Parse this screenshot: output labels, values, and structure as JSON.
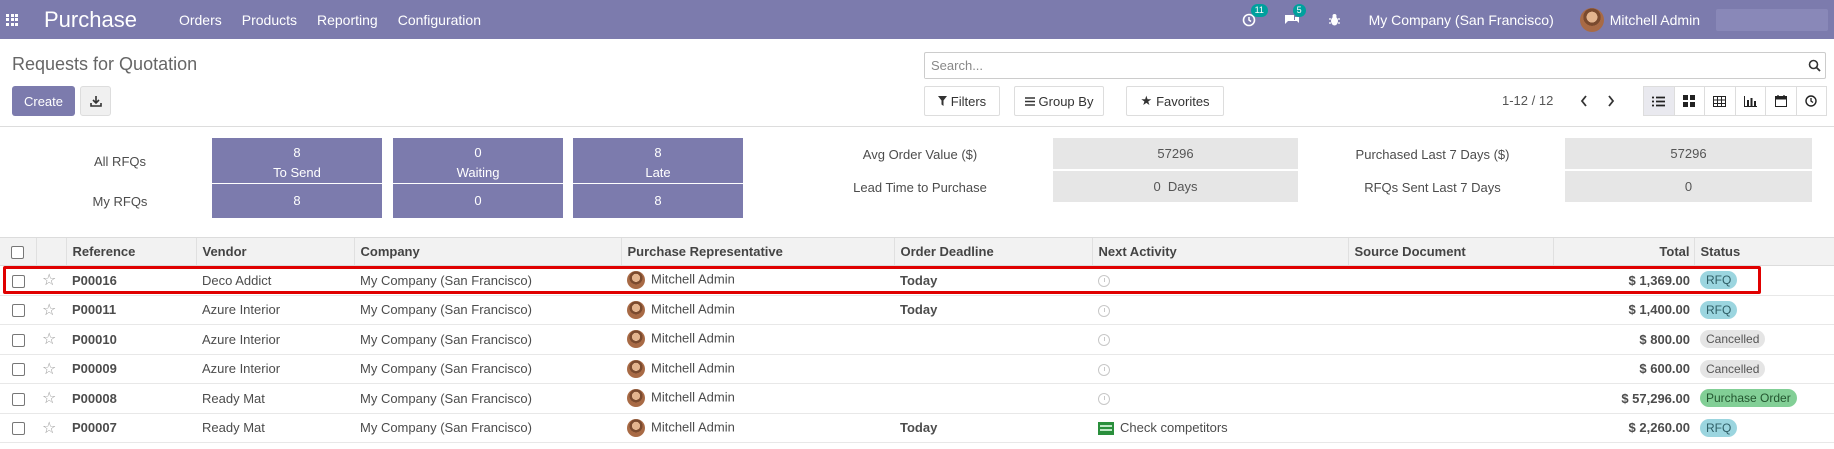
{
  "navbar": {
    "brand": "Purchase",
    "menu": [
      "Orders",
      "Products",
      "Reporting",
      "Configuration"
    ],
    "activity_count": "11",
    "message_count": "5",
    "company": "My Company (San Francisco)",
    "user": "Mitchell Admin"
  },
  "control_panel": {
    "title": "Requests for Quotation",
    "create_label": "Create",
    "search_placeholder": "Search...",
    "filters_label": "Filters",
    "groupby_label": "Group By",
    "favorites_label": "Favorites",
    "pager": "1-12 / 12"
  },
  "dashboard": {
    "all_rfqs_label": "All RFQs",
    "my_rfqs_label": "My RFQs",
    "tiles": [
      {
        "value": "8",
        "label": "To Send",
        "my": "8"
      },
      {
        "value": "0",
        "label": "Waiting",
        "my": "0"
      },
      {
        "value": "8",
        "label": "Late",
        "my": "8"
      }
    ],
    "kpis": [
      {
        "label": "Avg Order Value ($)",
        "value": "57296"
      },
      {
        "label": "Lead Time to Purchase",
        "value": "0  Days"
      },
      {
        "label": "Purchased Last 7 Days ($)",
        "value": "57296"
      },
      {
        "label": "RFQs Sent Last 7 Days",
        "value": "0"
      }
    ]
  },
  "table": {
    "columns": [
      "Reference",
      "Vendor",
      "Company",
      "Purchase Representative",
      "Order Deadline",
      "Next Activity",
      "Source Document",
      "Total",
      "Status"
    ],
    "rows": [
      {
        "ref": "P00016",
        "vendor": "Deco Addict",
        "company": "My Company (San Francisco)",
        "rep": "Mitchell Admin",
        "deadline": "Today",
        "activity": "",
        "source": "",
        "total": "$ 1,369.00",
        "status": "RFQ"
      },
      {
        "ref": "P00011",
        "vendor": "Azure Interior",
        "company": "My Company (San Francisco)",
        "rep": "Mitchell Admin",
        "deadline": "Today",
        "activity": "",
        "source": "",
        "total": "$ 1,400.00",
        "status": "RFQ"
      },
      {
        "ref": "P00010",
        "vendor": "Azure Interior",
        "company": "My Company (San Francisco)",
        "rep": "Mitchell Admin",
        "deadline": "",
        "activity": "",
        "source": "",
        "total": "$ 800.00",
        "status": "Cancelled"
      },
      {
        "ref": "P00009",
        "vendor": "Azure Interior",
        "company": "My Company (San Francisco)",
        "rep": "Mitchell Admin",
        "deadline": "",
        "activity": "",
        "source": "",
        "total": "$ 600.00",
        "status": "Cancelled"
      },
      {
        "ref": "P00008",
        "vendor": "Ready Mat",
        "company": "My Company (San Francisco)",
        "rep": "Mitchell Admin",
        "deadline": "",
        "activity": "",
        "source": "",
        "total": "$ 57,296.00",
        "status": "Purchase Order"
      },
      {
        "ref": "P00007",
        "vendor": "Ready Mat",
        "company": "My Company (San Francisco)",
        "rep": "Mitchell Admin",
        "deadline": "Today",
        "activity": "Check competitors",
        "source": "",
        "total": "$ 2,260.00",
        "status": "RFQ"
      }
    ]
  }
}
